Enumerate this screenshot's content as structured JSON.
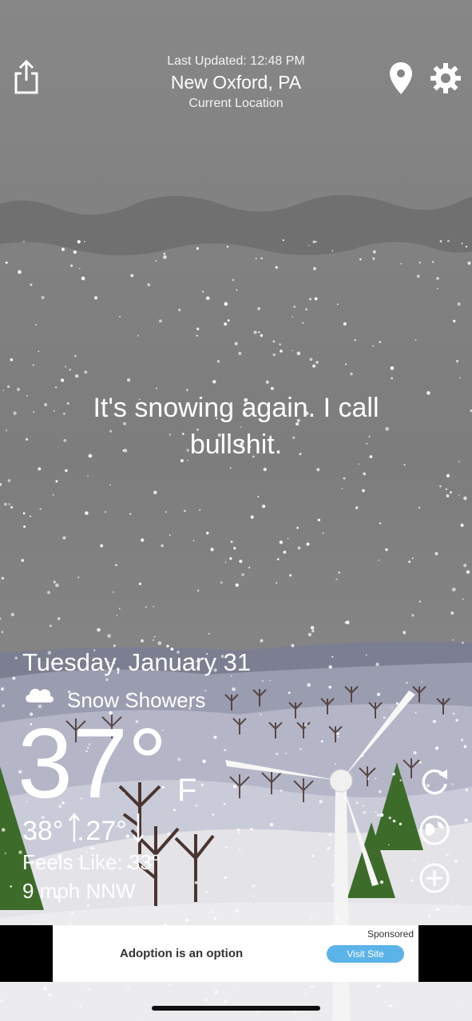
{
  "header": {
    "last_updated": "Last Updated: 12:48 PM",
    "city": "New Oxford, PA",
    "location_label": "Current Location"
  },
  "icons": {
    "share": "share-icon",
    "location": "location-pin-icon",
    "settings": "gear-icon",
    "refresh": "refresh-icon",
    "radar": "radar-icon",
    "add": "add-icon",
    "condition": "snow-cloud-icon"
  },
  "quote": "It's snowing again. I call bullshit.",
  "current": {
    "date": "Tuesday, January 31",
    "condition": "Snow Showers",
    "temp": "37°",
    "unit": "F",
    "high": "38°",
    "low": "27°",
    "feels_like": "Feels Like: 33°",
    "wind": "9 mph NNW"
  },
  "ad": {
    "sponsored": "Sponsored",
    "title": "Adoption is an option",
    "cta": "Visit Site"
  },
  "colors": {
    "sky": "#808080",
    "ad_button": "#5cb3e8",
    "tree_green": "#3d6b2a"
  }
}
